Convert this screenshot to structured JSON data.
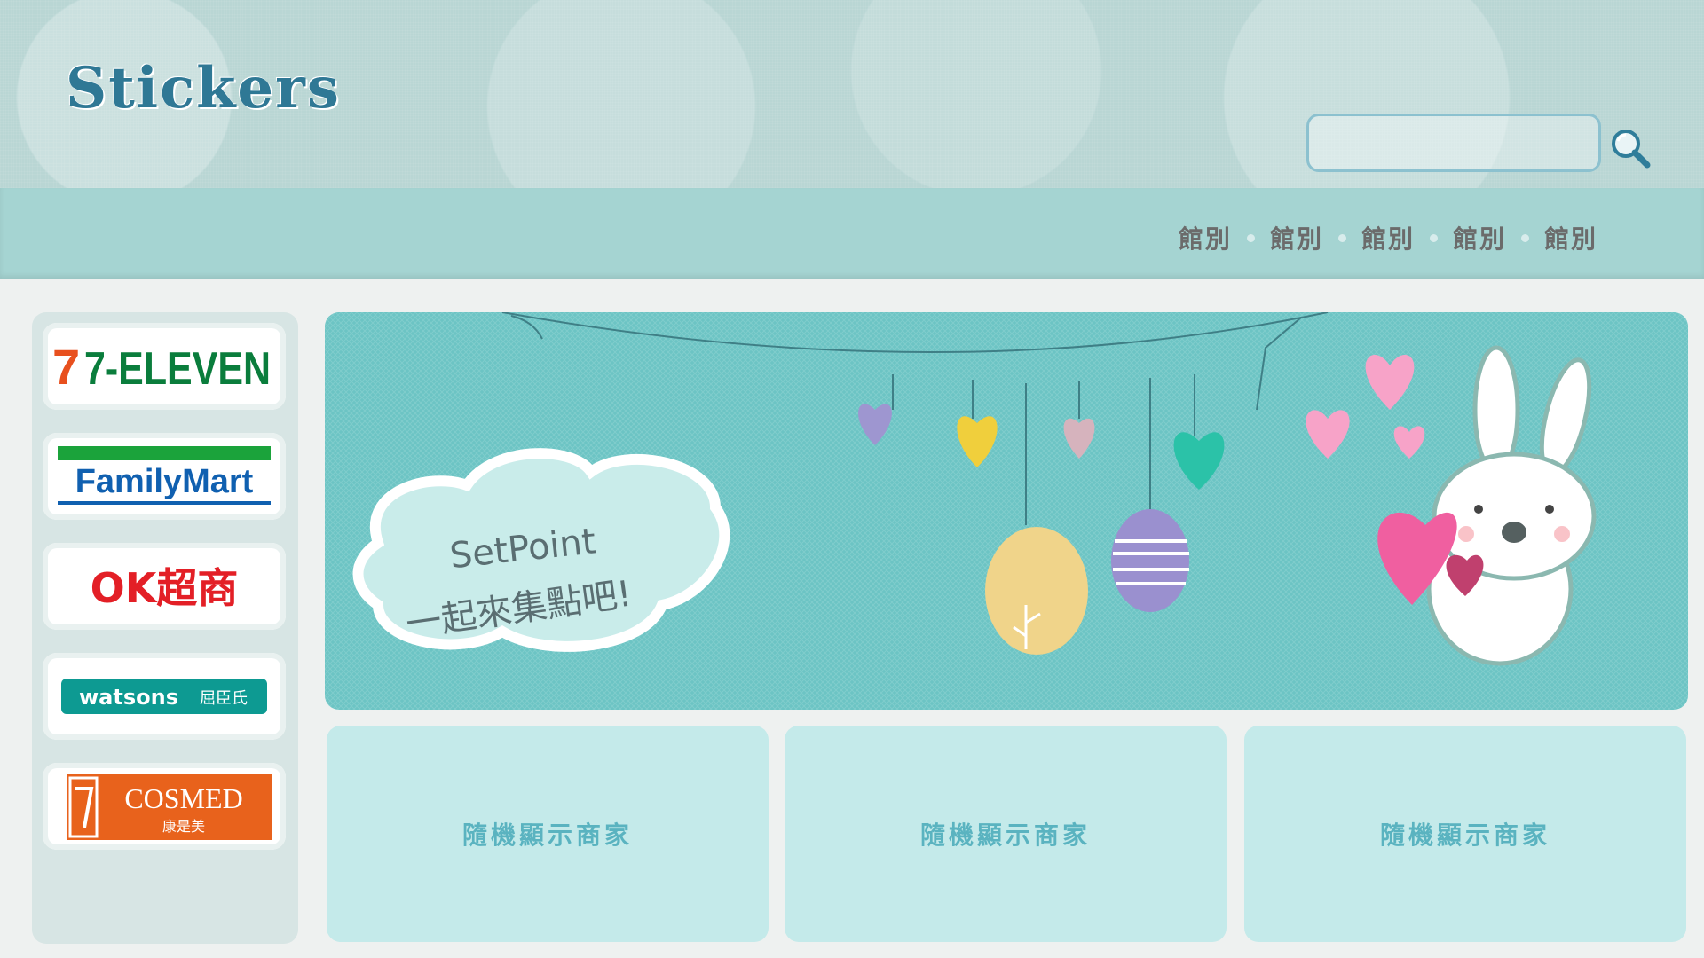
{
  "header": {
    "logo": "Stickers",
    "search_value": ""
  },
  "nav": {
    "items": [
      {
        "label": "館別"
      },
      {
        "label": "館別"
      },
      {
        "label": "館別"
      },
      {
        "label": "館別"
      },
      {
        "label": "館別"
      }
    ]
  },
  "sidebar": {
    "stores": [
      {
        "name": "7-ELEVEN"
      },
      {
        "name": "FamilyMart"
      },
      {
        "name": "OK超商"
      },
      {
        "name": "watsons",
        "name_local": "屈臣氏"
      },
      {
        "name": "COSMED",
        "name_local": "康是美"
      }
    ]
  },
  "banner": {
    "line1": "SetPoint",
    "line2": "一起來集點吧!"
  },
  "tiles": [
    {
      "label": "隨機顯示商家"
    },
    {
      "label": "隨機顯示商家"
    },
    {
      "label": "隨機顯示商家"
    }
  ],
  "colors": {
    "header_bg": "#b9d6d4",
    "nav_bg": "#a5d4d2",
    "tile_bg": "#c4eaea",
    "tile_text": "#5ab3c0",
    "banner_bg": "#6cc4c4",
    "logo": "#2f7895"
  }
}
